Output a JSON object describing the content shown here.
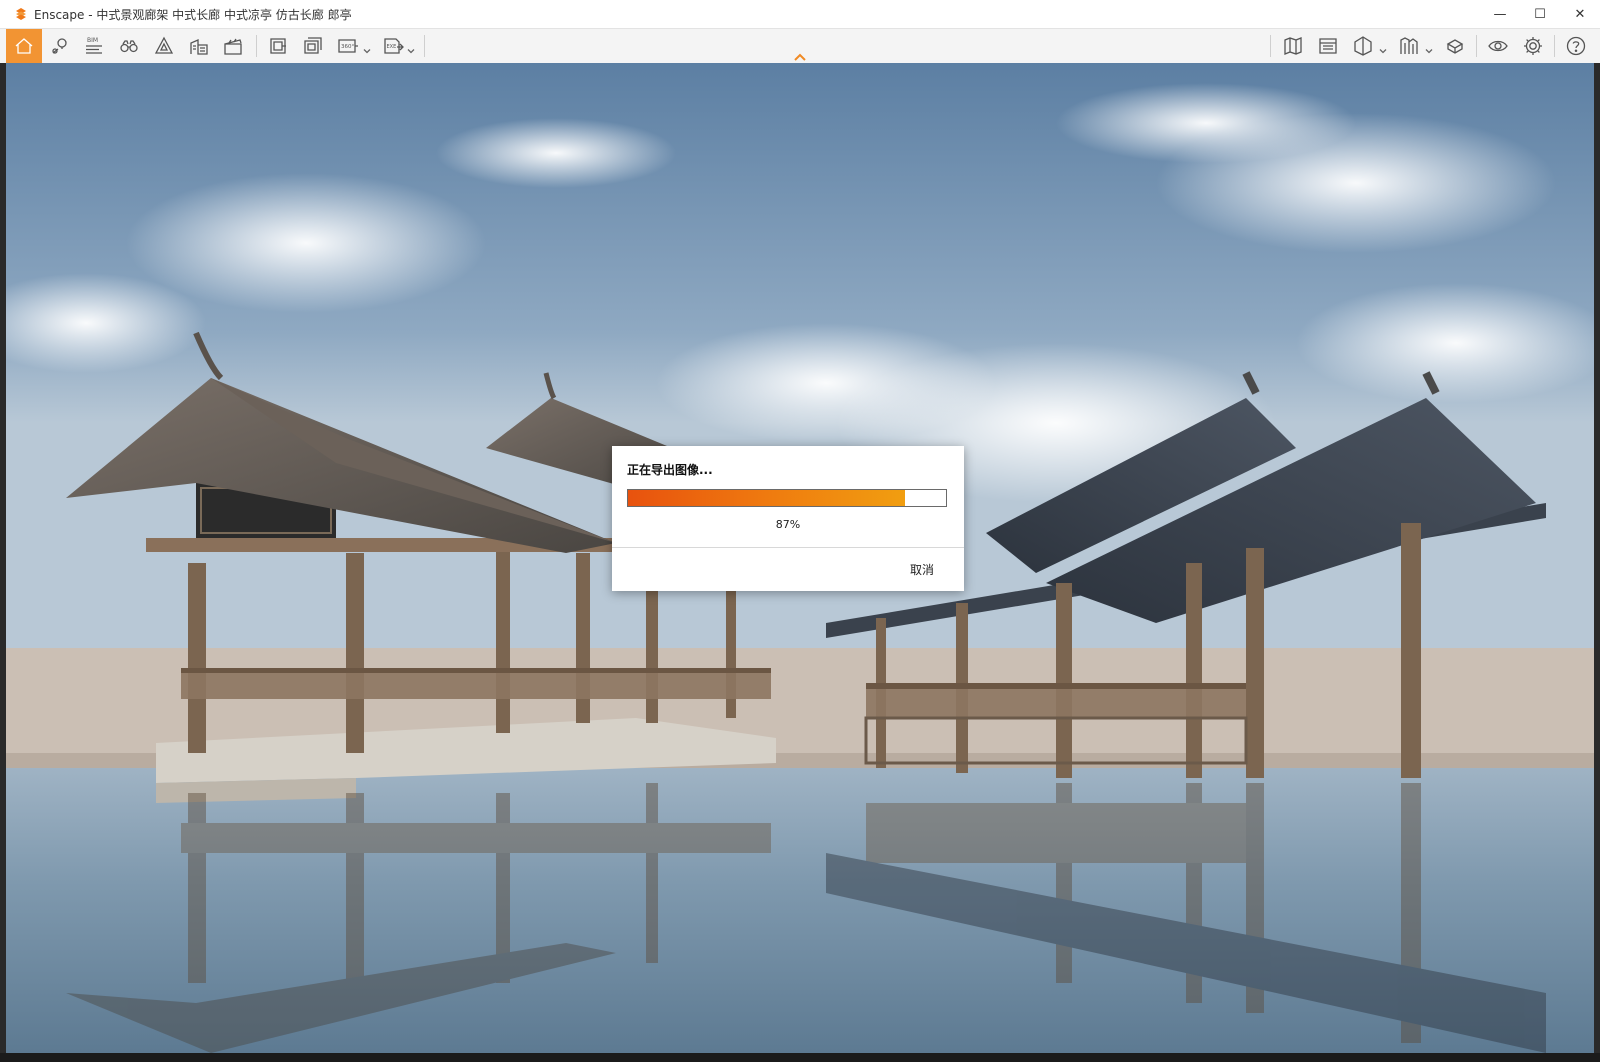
{
  "window": {
    "title": "Enscape - 中式景观廊架 中式长廊 中式凉亭 仿古长廊 郎亭",
    "minimize_label": "—",
    "maximize_label": "☐",
    "close_label": "✕"
  },
  "toolbar": {
    "left_icons": [
      "home-icon",
      "map-pin-icon",
      "bim-icon",
      "binoculars-icon",
      "atmosphere-icon",
      "buildings-icon",
      "clapper-icon",
      "screenshot-icon",
      "batch-render-icon",
      "panorama-360-icon",
      "export-exe-icon"
    ],
    "right_icons": [
      "map-icon",
      "view-manager-icon",
      "cube-icon",
      "asset-library-icon",
      "material-icon",
      "visual-settings-icon",
      "settings-gear-icon",
      "help-icon"
    ],
    "bim_label": "BIM",
    "pano_label": "360°",
    "exe_label": "EXE"
  },
  "dialog": {
    "title": "正在导出图像...",
    "progress_percent": 87,
    "progress_text": "87%",
    "cancel_label": "取消"
  },
  "colors": {
    "accent": "#f29433",
    "progress_start": "#e8520e",
    "progress_end": "#f19e10"
  }
}
